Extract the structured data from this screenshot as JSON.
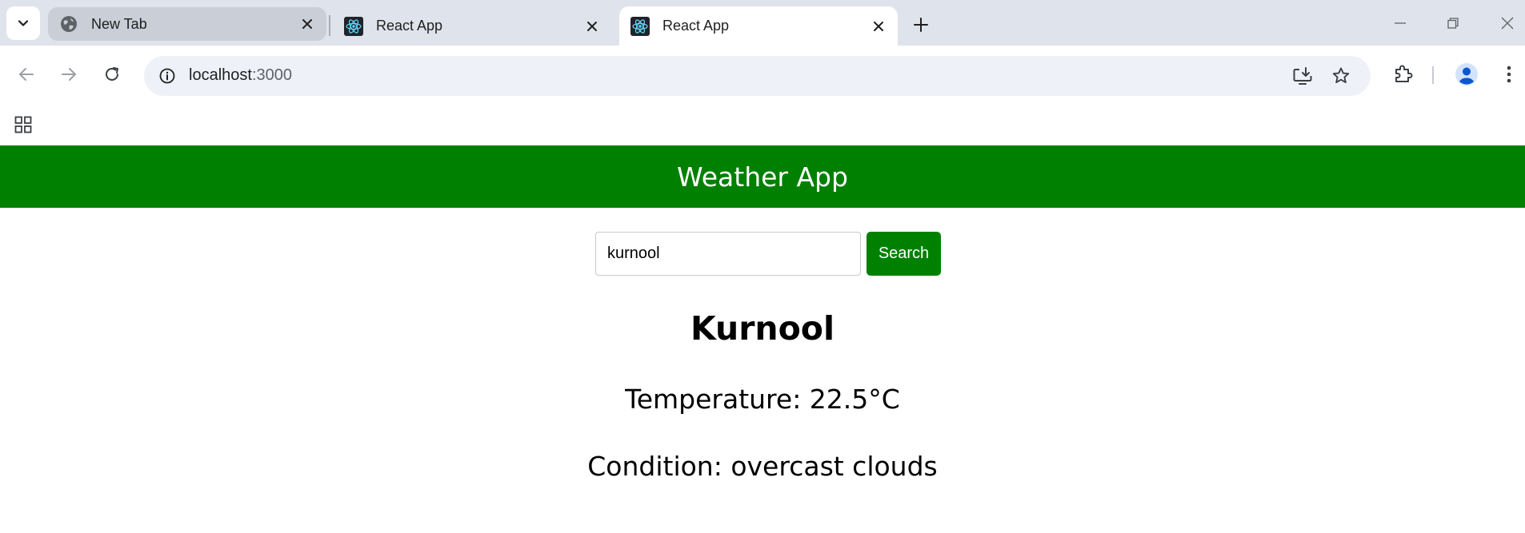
{
  "browser": {
    "tabs": [
      {
        "title": "New Tab",
        "icon": "globe-icon",
        "state": "inactive"
      },
      {
        "title": "React App",
        "icon": "react-icon",
        "state": "inactive"
      },
      {
        "title": "React App",
        "icon": "react-icon",
        "state": "active"
      }
    ],
    "address": {
      "host": "localhost",
      "port": ":3000"
    }
  },
  "app": {
    "header_title": "Weather App",
    "search": {
      "value": "kurnool",
      "button_label": "Search"
    },
    "result": {
      "city": "Kurnool",
      "temperature": "Temperature: 22.5°C",
      "condition": "Condition: overcast clouds"
    }
  },
  "colors": {
    "header": "#008000",
    "button": "#008000",
    "tabstrip": "#dfe3eb"
  }
}
